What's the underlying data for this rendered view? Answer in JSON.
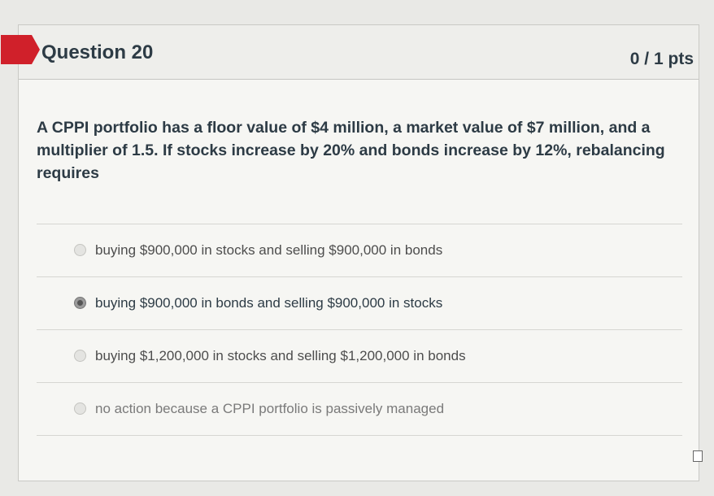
{
  "question": {
    "title": "Question 20",
    "points": "0 / 1 pts",
    "text": "A CPPI portfolio has a floor value of $4 million, a market value of $7 million, and a multiplier of 1.5.  If stocks increase by 20% and bonds increase by 12%, rebalancing requires"
  },
  "answers": [
    {
      "label": "buying $900,000 in stocks and selling $900,000 in bonds",
      "selected": false
    },
    {
      "label": "buying $900,000 in bonds and selling $900,000 in stocks",
      "selected": true
    },
    {
      "label": "buying $1,200,000 in stocks and selling $1,200,000 in bonds",
      "selected": false
    },
    {
      "label": "no action because a CPPI portfolio is passively managed",
      "selected": false
    }
  ],
  "colors": {
    "flag": "#d0202a",
    "text": "#2d3b45"
  },
  "icons": {
    "flag": "incorrect-flag-icon",
    "resize": "resize-handle-icon"
  }
}
